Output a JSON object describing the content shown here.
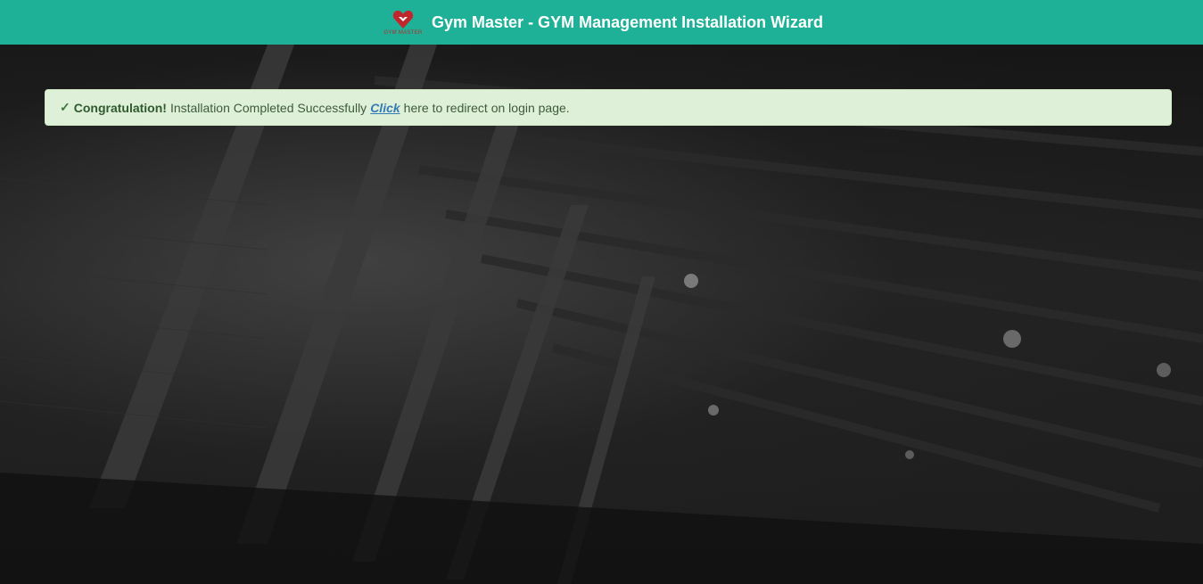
{
  "header": {
    "logo_caption": "GYM MASTER",
    "title": "Gym Master - GYM Management Installation Wizard"
  },
  "alert": {
    "check": "✓",
    "strong": "Congratulation!",
    "message": "Installation Completed Successfully",
    "link_text": "Click",
    "tail": "here to redirect on login page."
  },
  "colors": {
    "header_bg": "#1fb197",
    "alert_bg": "#dff0d8",
    "alert_text": "#3c763d",
    "link": "#337ab7",
    "logo": "#c0272d"
  },
  "icons": {
    "logo": "gym-master-heart-logo-icon",
    "check": "check-icon"
  }
}
